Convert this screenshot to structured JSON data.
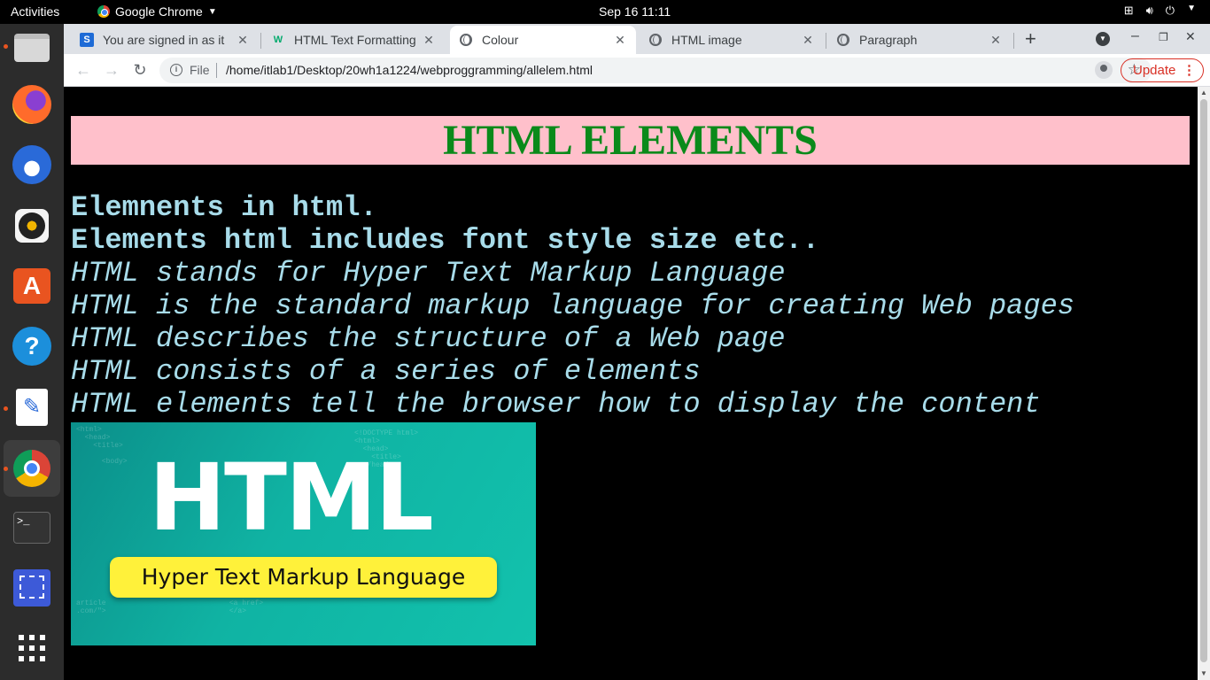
{
  "topbar": {
    "activities": "Activities",
    "app_name": "Google Chrome",
    "clock": "Sep 16  11:11"
  },
  "dock": {
    "items": [
      "files-icon",
      "firefox-icon",
      "thunderbird-icon",
      "rhythmbox-icon",
      "software-icon",
      "help-icon",
      "text-editor-icon",
      "chrome-icon",
      "terminal-icon",
      "screenshot-icon",
      "app-grid-icon"
    ]
  },
  "tabs": [
    {
      "title": "You are signed in as it",
      "favicon": "S"
    },
    {
      "title": "HTML Text Formatting",
      "favicon": "W"
    },
    {
      "title": "Colour",
      "favicon": "globe"
    },
    {
      "title": "HTML image",
      "favicon": "globe"
    },
    {
      "title": "Paragraph",
      "favicon": "globe"
    }
  ],
  "toolbar": {
    "scheme_label": "File",
    "url": "/home/itlab1/Desktop/20wh1a1224/webproggramming/allelem.html",
    "update_label": "Update"
  },
  "page": {
    "heading": "HTML ELEMENTS",
    "bold_lines": [
      "Elemnents in html.",
      "Elements html includes font style size etc.."
    ],
    "italic_lines": [
      "HTML stands for Hyper Text Markup Language",
      "HTML is the standard markup language for creating Web pages",
      "HTML describes the structure of a Web page",
      "HTML consists of a series of elements",
      "HTML elements tell the browser how to display the content"
    ],
    "image": {
      "big_text": "HTML",
      "pill_text": "Hyper Text Markup Language"
    }
  },
  "colors": {
    "heading_bg": "#ffc0cb",
    "heading_text": "#0a8a1a",
    "body_text": "#a8dcea",
    "page_bg": "#000000",
    "update_accent": "#d93025"
  }
}
